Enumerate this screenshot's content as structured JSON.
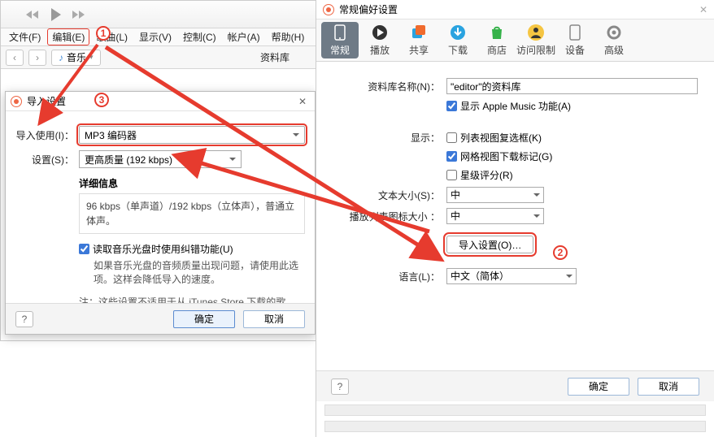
{
  "itunes": {
    "menus": [
      "文件(F)",
      "编辑(E)",
      "歌曲(L)",
      "显示(V)",
      "控制(C)",
      "帐户(A)",
      "帮助(H)"
    ],
    "active_menu_index": 1,
    "music_label": "音乐",
    "library_label": "资料库",
    "caret": "›"
  },
  "import_dialog": {
    "title": "导入设置",
    "row_use_label": "导入使用(I)：",
    "row_use_value": "MP3 编码器",
    "row_setting_label": "设置(S)：",
    "row_setting_value": "更高质量 (192 kbps)",
    "detail_title": "详细信息",
    "detail_text": "96 kbps（单声道）/192 kbps（立体声），普通立体声。",
    "chk_label": "读取音乐光盘时使用纠错功能(U)",
    "chk_note": "如果音乐光盘的音频质量出现问题，请使用此选项。这样会降低导入的速度。",
    "note2": "注：这些设置不适用于从 iTunes Store 下载的歌曲。",
    "ok": "确定",
    "cancel": "取消"
  },
  "prefs": {
    "title": "常规偏好设置",
    "tabs": [
      {
        "label": "常规",
        "icon": "phone"
      },
      {
        "label": "播放",
        "icon": "play"
      },
      {
        "label": "共享",
        "icon": "share"
      },
      {
        "label": "下载",
        "icon": "download"
      },
      {
        "label": "商店",
        "icon": "bag"
      },
      {
        "label": "访问限制",
        "icon": "person"
      },
      {
        "label": "设备",
        "icon": "device"
      },
      {
        "label": "高级",
        "icon": "gear"
      }
    ],
    "lib_name_label": "资料库名称(N)：",
    "lib_name_value": "\"editor\"的资料库",
    "show_apple_music": "显示 Apple Music 功能(A)",
    "views_label": "显示：",
    "chk_list_checkbox": "列表视图复选框(K)",
    "chk_grid_marker": "网格视图下载标记(G)",
    "chk_star_rating": "星级评分(R)",
    "font_size_label": "文本大小(S)：",
    "font_size_value": "中",
    "playlist_icon_label": "播放列表图标大小 ：",
    "playlist_icon_value": "中",
    "import_settings_btn": "导入设置(O)…",
    "language_label": "语言(L)：",
    "language_value": "中文（简体）",
    "ok": "确定",
    "cancel": "取消"
  },
  "annotations": {
    "n1": "1",
    "n2": "2",
    "n3": "3"
  }
}
